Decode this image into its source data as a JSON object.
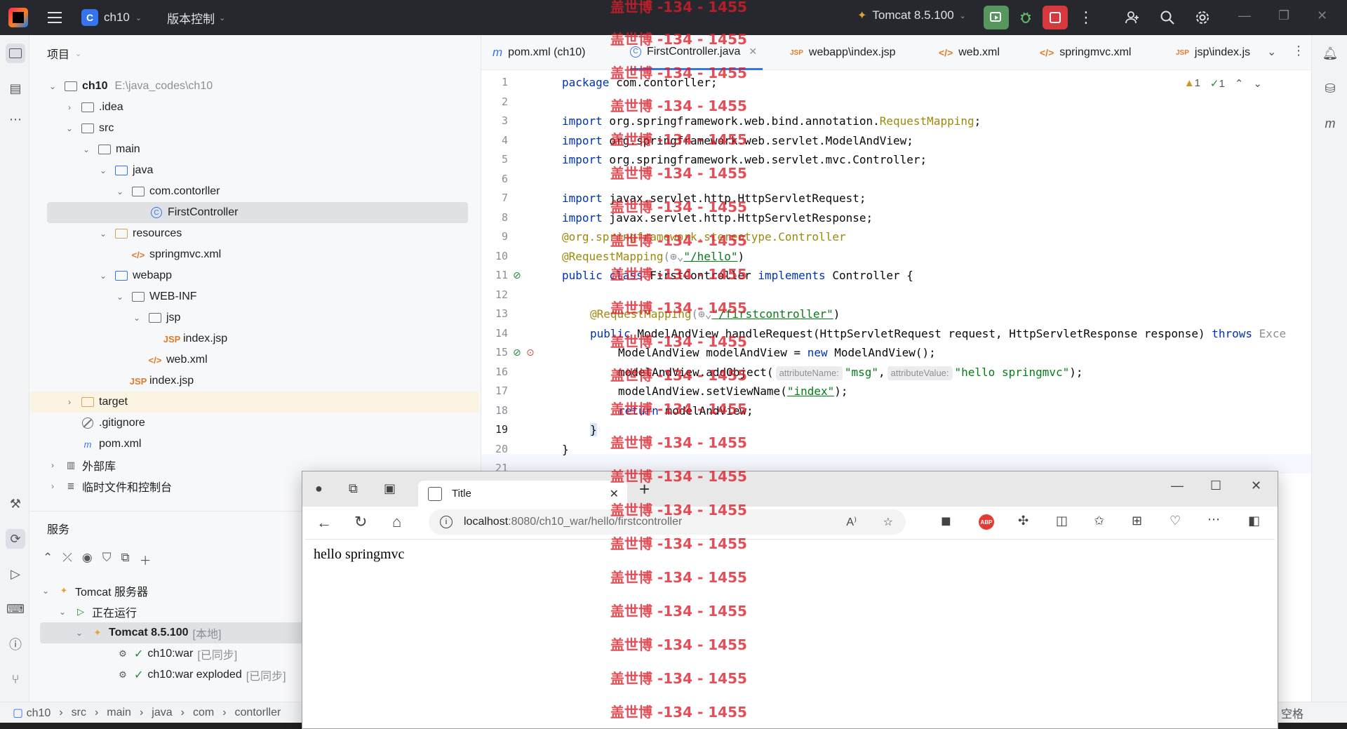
{
  "titlebar": {
    "project_badge": "C",
    "project_name": "ch10",
    "vcs_label": "版本控制",
    "run_config": "Tomcat 8.5.100"
  },
  "project_panel": {
    "title": "项目",
    "tree": [
      {
        "label": "ch10",
        "note": "E:\\java_codes\\ch10"
      },
      {
        "label": ".idea"
      },
      {
        "label": "src"
      },
      {
        "label": "main"
      },
      {
        "label": "java"
      },
      {
        "label": "com.contorller"
      },
      {
        "label": "FirstController"
      },
      {
        "label": "resources"
      },
      {
        "label": "springmvc.xml"
      },
      {
        "label": "webapp"
      },
      {
        "label": "WEB-INF"
      },
      {
        "label": "jsp"
      },
      {
        "label": "index.jsp"
      },
      {
        "label": "web.xml"
      },
      {
        "label": "index.jsp"
      },
      {
        "label": "target"
      },
      {
        "label": ".gitignore"
      },
      {
        "label": "pom.xml"
      },
      {
        "label": "外部库"
      },
      {
        "label": "临时文件和控制台"
      }
    ]
  },
  "services": {
    "title": "服务",
    "tree": [
      {
        "label": "Tomcat 服务器"
      },
      {
        "label": "正在运行"
      },
      {
        "label": "Tomcat 8.5.100",
        "status": "[本地]"
      },
      {
        "label": "ch10:war",
        "status": "[已同步]"
      },
      {
        "label": "ch10:war exploded",
        "status": "[已同步]"
      }
    ]
  },
  "editor": {
    "tabs": [
      {
        "label": "pom.xml (ch10)"
      },
      {
        "label": "FirstController.java"
      },
      {
        "label": "webapp\\index.jsp"
      },
      {
        "label": "web.xml"
      },
      {
        "label": "springmvc.xml"
      },
      {
        "label": "jsp\\index.js"
      }
    ],
    "warnings": "1",
    "weak_warnings": "1",
    "line_numbers": [
      "1",
      "2",
      "3",
      "4",
      "5",
      "6",
      "7",
      "8",
      "9",
      "10",
      "11",
      "12",
      "13",
      "14",
      "15",
      "16",
      "17",
      "18",
      "19",
      "20",
      "21"
    ],
    "code": {
      "l1_kw": "package",
      "l1_rest": " com.contorller;",
      "l3_kw": "import",
      "l3_rest": " org.springframework.web.bind.annotation.",
      "l3_ann": "RequestMapping",
      "l3_end": ";",
      "l4_kw": "import",
      "l4_rest": " org.springframework.web.servlet.ModelAndView;",
      "l5_kw": "import",
      "l5_rest": " org.springframework.web.servlet.mvc.Controller;",
      "l7_kw": "import",
      "l7_rest": " javax.servlet.http.HttpServletRequest;",
      "l8_kw": "import",
      "l8_rest": " javax.servlet.http.HttpServletResponse;",
      "l9_ann": "@org.springframework.stereotype.",
      "l9_ann2": "Controller",
      "l10_ann": "@RequestMapping",
      "l10_mid": "(⊕⌄",
      "l10_str": "\"/hello\"",
      "l10_end": ")",
      "l11_kw": "public class",
      "l11_mid": " FirstController ",
      "l11_kw2": "implements",
      "l11_end": " Controller {",
      "l13_ann": "@RequestMapping",
      "l13_mid": "(⊕⌄",
      "l13_str": "\"/firstcontroller\"",
      "l13_end": ")",
      "l14_kw": "public",
      "l14_mid": " ModelAndView handleRequest(HttpServletRequest request, HttpServletResponse response) ",
      "l14_kw2": "throws",
      "l14_end": " Exce",
      "l15_pre": "ModelAndView modelAndView = ",
      "l15_kw": "new",
      "l15_end": " ModelAndView();",
      "l16_pre": "modelAndView.addObject(",
      "l16_hint1": "attributeName:",
      "l16_str1": "\"msg\"",
      "l16_comma": ",",
      "l16_hint2": "attributeValue:",
      "l16_str2": "\"hello springmvc\"",
      "l16_end": ");",
      "l17_pre": "modelAndView.setViewName(",
      "l17_str": "\"index\"",
      "l17_end": ");",
      "l18_kw": "return",
      "l18_end": " modelAndView;",
      "l19": "}",
      "l20": "}"
    }
  },
  "breadcrumb": [
    "ch10",
    "src",
    "main",
    "java",
    "com",
    "contorller"
  ],
  "breadcrumb_right": "空格",
  "browser": {
    "tab_title": "Title",
    "url_host": "localhost",
    "url_path": ":8080/ch10_war/hello/firstcontroller",
    "abp_label": "ABP",
    "content_text": "hello springmvc"
  },
  "watermark_text": "盖世博 -134 - 1455",
  "colors": {
    "accent": "#3574f0",
    "run_green": "#57965c",
    "stop_red": "#d5393e",
    "keyword": "#0033b3",
    "annotation": "#9e880d",
    "string": "#067d17",
    "watermark": "#dc1e28"
  },
  "icons": [
    "app-logo-icon",
    "menu-icon",
    "run-icon",
    "debug-icon",
    "stop-icon",
    "more-icon",
    "add-user-icon",
    "search-icon",
    "gear-icon",
    "folder-icon",
    "class-icon",
    "jsp-icon",
    "xml-icon",
    "maven-icon",
    "ignore-icon",
    "bell-icon",
    "database-icon",
    "back-icon",
    "reload-icon",
    "home-icon",
    "info-icon",
    "star-icon",
    "close-icon"
  ]
}
